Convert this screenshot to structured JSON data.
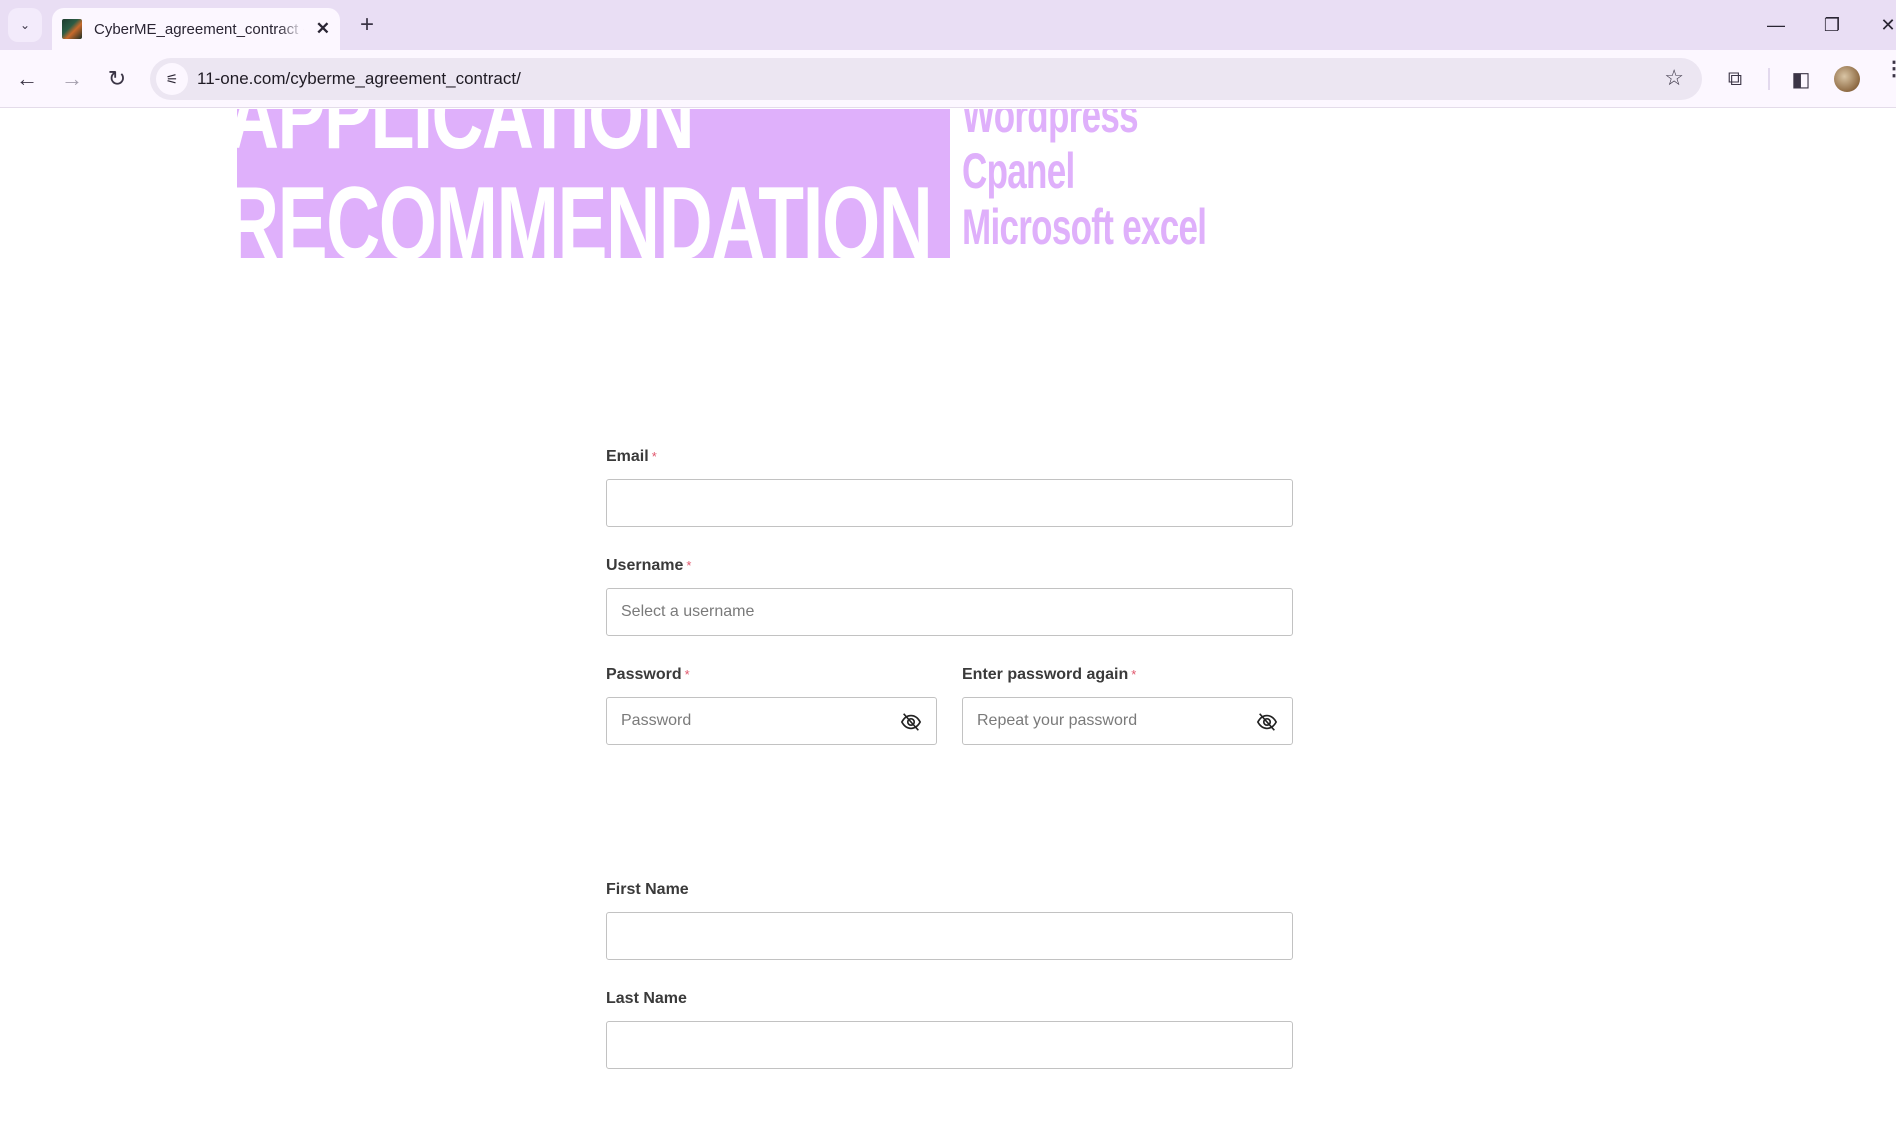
{
  "browser": {
    "tab_title": "CyberME_agreement_contract - ",
    "url": "11-one.com/cyberme_agreement_contract/",
    "icons": {
      "tab_search": "chevron-down-icon",
      "new_tab": "plus-icon",
      "back": "arrow-left-icon",
      "forward": "arrow-right-icon",
      "reload": "reload-icon",
      "site_info": "tune-icon",
      "bookmark": "star-icon",
      "extensions": "puzzle-icon",
      "side_panel": "side-panel-icon",
      "profile": "avatar",
      "menu": "kebab-menu-icon"
    },
    "glyphs": {
      "tab_search": "⌄",
      "tab_close": "✕",
      "new_tab": "+",
      "back": "←",
      "forward": "→",
      "reload": "↻",
      "site_info": "⚟",
      "bookmark": "☆",
      "extensions": "⧉",
      "side_panel": "◧",
      "menu": "⋮",
      "minimize": "—",
      "restore": "❐",
      "close": "✕"
    }
  },
  "hero": {
    "banner_top": "APPLICATION",
    "banner_bottom": "RECOMMENDATION",
    "skills": [
      "Wordpress",
      "Cpanel",
      "Microsoft excel"
    ],
    "accent_color": "#dfb0fb"
  },
  "form": {
    "required_mark": "*",
    "email": {
      "label": "Email",
      "value": "",
      "placeholder": ""
    },
    "username": {
      "label": "Username",
      "value": "",
      "placeholder": "Select a username"
    },
    "password": {
      "label": "Password",
      "value": "",
      "placeholder": "Password"
    },
    "password_repeat": {
      "label": "Enter password again",
      "value": "",
      "placeholder": "Repeat your password"
    },
    "first_name": {
      "label": "First Name",
      "value": "",
      "placeholder": ""
    },
    "last_name": {
      "label": "Last Name",
      "value": "",
      "placeholder": ""
    }
  }
}
